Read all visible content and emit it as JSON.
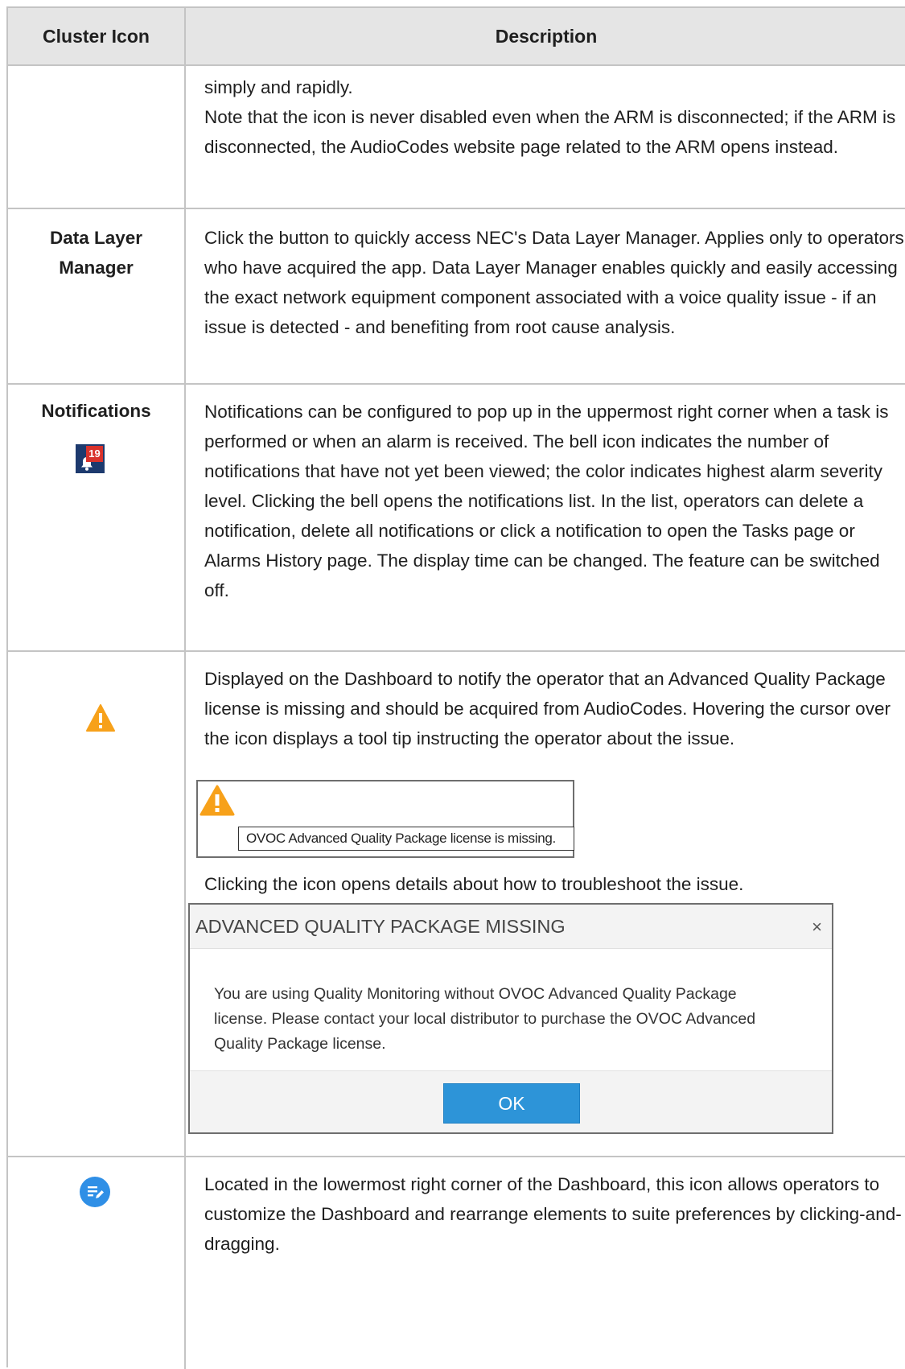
{
  "header": {
    "col1": "Cluster Icon",
    "col2": "Description"
  },
  "row0": {
    "desc": [
      "simply and rapidly.",
      "Note that the icon is never disabled even when the ARM is disconnected; if the ARM is disconnected, the AudioCodes website page related to the ARM opens instead."
    ]
  },
  "row1": {
    "name": "Data Layer Manager",
    "desc": "Click the button to quickly access NEC's Data Layer Manager. Applies only to operators who have acquired the app. Data Layer Manager enables quickly and easily accessing the exact network equipment component associated with a voice quality issue - if an issue is detected - and benefiting from root cause analysis."
  },
  "row2": {
    "name": "Notifications",
    "badge": "19",
    "icon": "bell-icon",
    "desc": "Notifications can be configured to pop up in the uppermost right corner when a task is performed or when an alarm is received. The bell icon indicates the number of notifications that have not yet been viewed; the color indicates highest alarm severity level. Clicking the bell opens the notifications list. In the list, operators can delete a notification, delete all notifications or click a notification to open the Tasks page or Alarms History page. The display time can be changed. The feature can be switched off."
  },
  "row3": {
    "icon": "warning-icon",
    "desc1": "Displayed on the Dashboard to notify the operator that an Advanced Quality Package license is missing and should be acquired from AudioCodes. Hovering the cursor over the icon displays a tool tip instructing the operator about the issue.",
    "tooltip": "OVOC Advanced Quality Package license is missing.",
    "desc2": "Clicking the icon opens details about how to troubleshoot the issue.",
    "dialog": {
      "title": "ADVANCED QUALITY PACKAGE MISSING",
      "close": "×",
      "body": "You are using Quality Monitoring without OVOC Advanced Quality Package license. Please contact your local distributor to purchase the OVOC Advanced Quality Package license.",
      "ok": "OK"
    }
  },
  "row4": {
    "icon": "edit-icon",
    "desc": "Located in the lowermost right corner of the Dashboard, this icon allows operators to customize the Dashboard and rearrange elements to suite preferences by clicking-and-dragging."
  },
  "colors": {
    "header_bg": "#e5e5e5",
    "border": "#c4c4c4",
    "bell_bg": "#1d3a6e",
    "badge": "#d9322b",
    "warning": "#f7a11a",
    "ok_button": "#2d94d8",
    "edit_icon": "#2f8fe6"
  }
}
